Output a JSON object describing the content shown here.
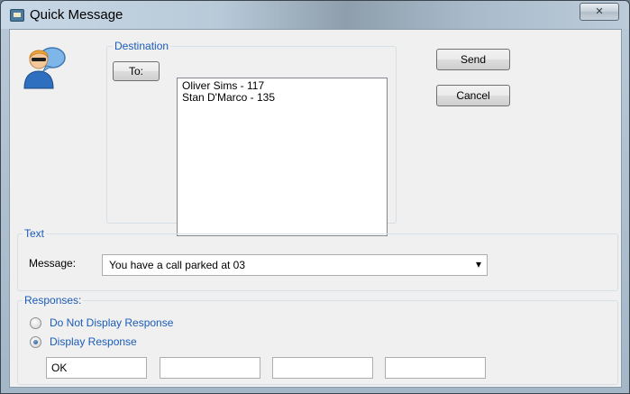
{
  "window": {
    "title": "Quick Message",
    "close_glyph": "✕"
  },
  "destination": {
    "legend": "Destination",
    "to_button": "To:",
    "recipients": [
      "Oliver Sims - 117",
      "Stan D'Marco - 135"
    ]
  },
  "actions": {
    "send": "Send",
    "cancel": "Cancel"
  },
  "text_group": {
    "legend": "Text",
    "message_label": "Message:",
    "message_value": "You have a call parked at 03",
    "dropdown_glyph": "▾"
  },
  "responses": {
    "legend": "Responses:",
    "options": [
      {
        "label": "Do Not Display Response",
        "selected": false
      },
      {
        "label": "Display Response",
        "selected": true
      }
    ],
    "fields": [
      "OK",
      "",
      "",
      ""
    ]
  },
  "icons": {
    "window": "app-message-icon",
    "avatar": "user-chat-icon"
  }
}
